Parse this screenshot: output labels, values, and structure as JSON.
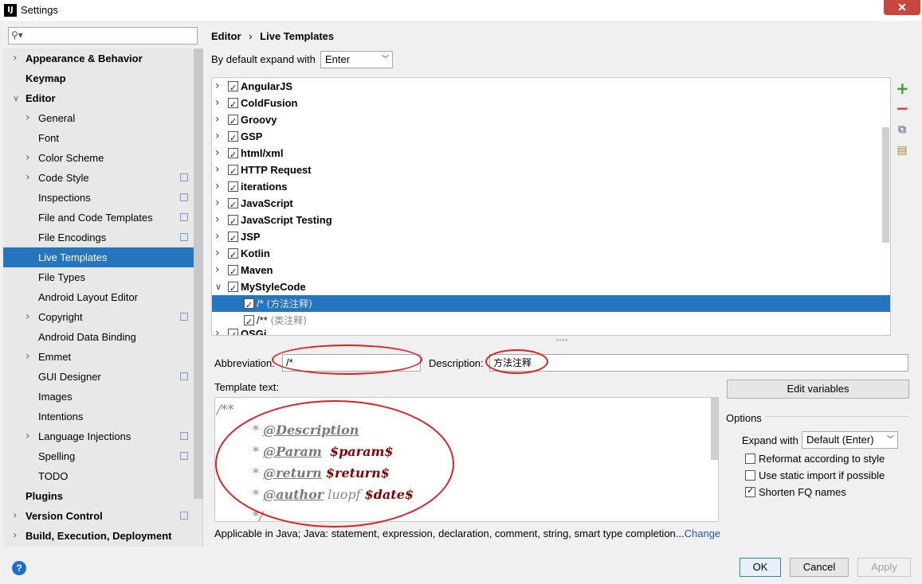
{
  "window": {
    "title": "Settings",
    "app_icon": "IJ",
    "close": "✕"
  },
  "search": {
    "placeholder": ""
  },
  "sidebar": {
    "items": [
      {
        "label": "Appearance & Behavior",
        "level": 0,
        "bold": true,
        "arrow": "right"
      },
      {
        "label": "Keymap",
        "level": 0,
        "bold": true
      },
      {
        "label": "Editor",
        "level": 0,
        "bold": true,
        "arrow": "down"
      },
      {
        "label": "General",
        "level": 1,
        "arrow": "right"
      },
      {
        "label": "Font",
        "level": 1
      },
      {
        "label": "Color Scheme",
        "level": 1,
        "arrow": "right"
      },
      {
        "label": "Code Style",
        "level": 1,
        "arrow": "right",
        "project_icon": true
      },
      {
        "label": "Inspections",
        "level": 1,
        "project_icon": true
      },
      {
        "label": "File and Code Templates",
        "level": 1,
        "project_icon": true
      },
      {
        "label": "File Encodings",
        "level": 1,
        "project_icon": true
      },
      {
        "label": "Live Templates",
        "level": 1,
        "selected": true
      },
      {
        "label": "File Types",
        "level": 1
      },
      {
        "label": "Android Layout Editor",
        "level": 1
      },
      {
        "label": "Copyright",
        "level": 1,
        "arrow": "right",
        "project_icon": true
      },
      {
        "label": "Android Data Binding",
        "level": 1
      },
      {
        "label": "Emmet",
        "level": 1,
        "arrow": "right"
      },
      {
        "label": "GUI Designer",
        "level": 1,
        "project_icon": true
      },
      {
        "label": "Images",
        "level": 1
      },
      {
        "label": "Intentions",
        "level": 1
      },
      {
        "label": "Language Injections",
        "level": 1,
        "arrow": "right",
        "project_icon": true
      },
      {
        "label": "Spelling",
        "level": 1,
        "project_icon": true
      },
      {
        "label": "TODO",
        "level": 1
      },
      {
        "label": "Plugins",
        "level": 0,
        "bold": true
      },
      {
        "label": "Version Control",
        "level": 0,
        "bold": true,
        "arrow": "right",
        "project_icon": true
      },
      {
        "label": "Build, Execution, Deployment",
        "level": 0,
        "bold": true,
        "arrow": "right"
      }
    ]
  },
  "breadcrumb": {
    "parent": "Editor",
    "sep": "›",
    "current": "Live Templates"
  },
  "expand": {
    "label": "By default expand with",
    "value": "Enter"
  },
  "templates": {
    "groups": [
      {
        "name": "AngularJS",
        "checked": true,
        "expanded": false
      },
      {
        "name": "ColdFusion",
        "checked": true,
        "expanded": false
      },
      {
        "name": "Groovy",
        "checked": true,
        "expanded": false
      },
      {
        "name": "GSP",
        "checked": true,
        "expanded": false
      },
      {
        "name": "html/xml",
        "checked": true,
        "expanded": false
      },
      {
        "name": "HTTP Request",
        "checked": true,
        "expanded": false
      },
      {
        "name": "iterations",
        "checked": true,
        "expanded": false
      },
      {
        "name": "JavaScript",
        "checked": true,
        "expanded": false
      },
      {
        "name": "JavaScript Testing",
        "checked": true,
        "expanded": false
      },
      {
        "name": "JSP",
        "checked": true,
        "expanded": false
      },
      {
        "name": "Kotlin",
        "checked": true,
        "expanded": false
      },
      {
        "name": "Maven",
        "checked": true,
        "expanded": false
      },
      {
        "name": "MyStyleCode",
        "checked": true,
        "expanded": true
      }
    ],
    "children": [
      {
        "abbr": "/*",
        "desc": " (方法注释)",
        "checked": true,
        "selected": true
      },
      {
        "abbr": "/**",
        "desc": " (类注释)",
        "checked": true,
        "selected": false
      }
    ],
    "partial_group": "OSGi"
  },
  "toolbar": {
    "add": "+",
    "remove": "−",
    "copy": "⧉",
    "edit": "▤"
  },
  "abbreviation": {
    "label": "Abbreviation:",
    "value": "/*"
  },
  "description": {
    "label": "Description:",
    "value": "方法注释"
  },
  "template_text": {
    "label": "Template text:",
    "line1": "/**",
    "star": "* ",
    "tag_description": "@Description",
    "tag_param": "@Param",
    "var_param": "$param$",
    "tag_return": "@return",
    "var_return": "$return$",
    "tag_author": "@author",
    "author_name": " luopf ",
    "var_date": "$date$",
    "line_end": "*/"
  },
  "edit_variables": {
    "label": "Edit variables"
  },
  "options": {
    "title": "Options",
    "expand_label": "Expand with",
    "expand_value": "Default (Enter)",
    "reformat": {
      "label": "Reformat according to style",
      "checked": false
    },
    "static_import": {
      "label": "Use static import if possible",
      "checked": false
    },
    "shorten_fq": {
      "label": "Shorten FQ names",
      "checked": true
    }
  },
  "applicable": {
    "text": "Applicable in Java; Java: statement, expression, declaration, comment, string, smart type completion...",
    "link": "Change"
  },
  "buttons": {
    "ok": "OK",
    "cancel": "Cancel",
    "apply": "Apply"
  },
  "help": "?"
}
